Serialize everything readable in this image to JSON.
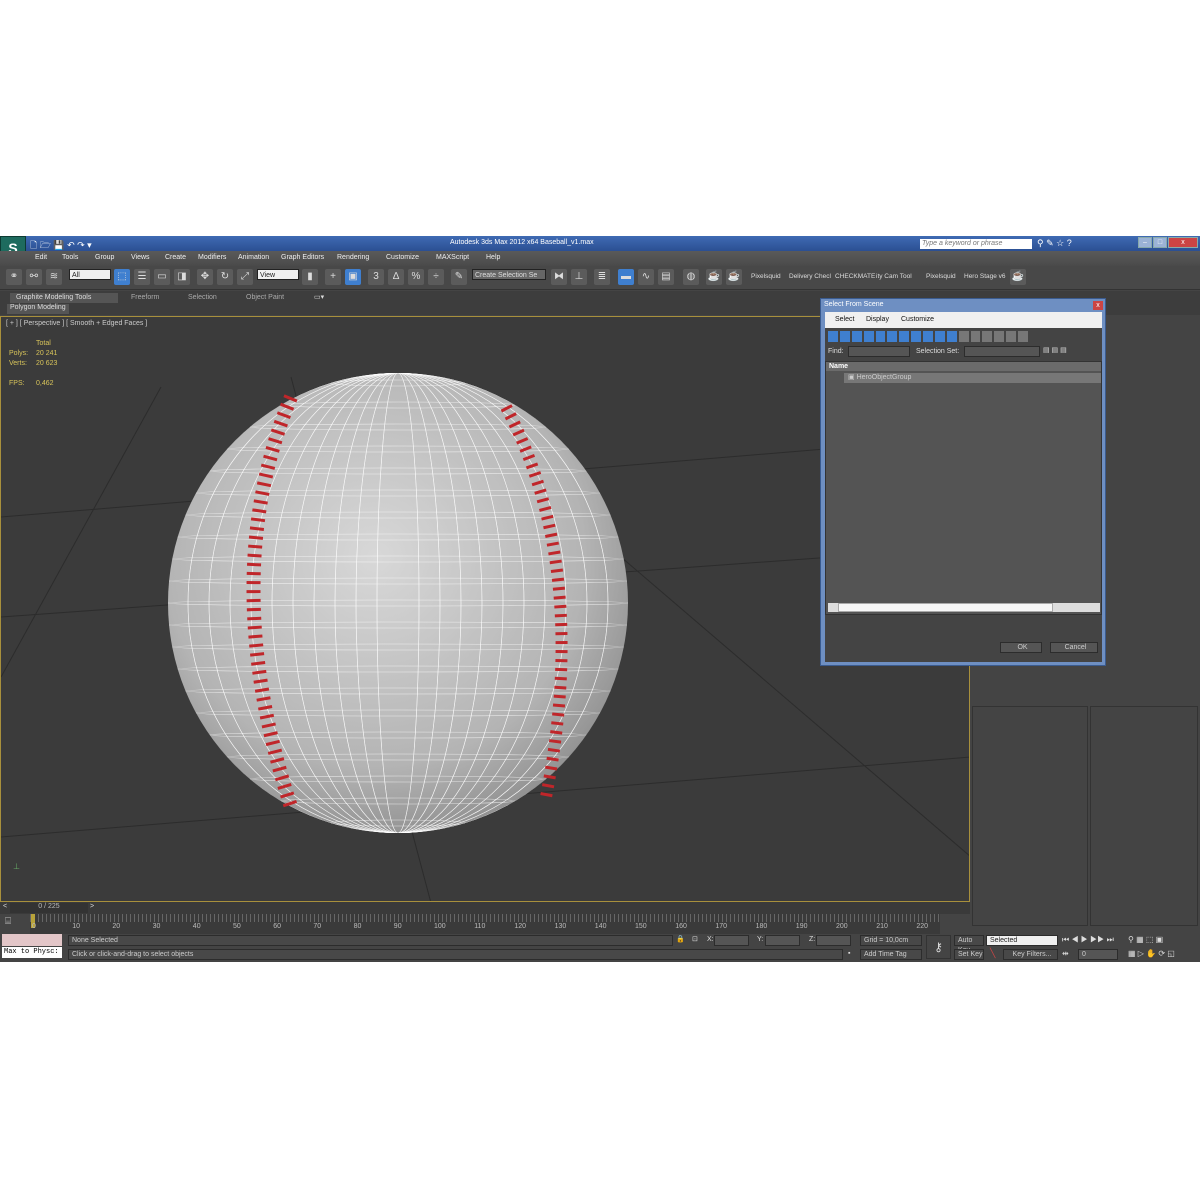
{
  "title": "Autodesk 3ds Max  2012 x64      Baseball_v1.max",
  "search_placeholder": "Type a keyword or phrase",
  "menu": [
    "Edit",
    "Tools",
    "Group",
    "Views",
    "Create",
    "Modifiers",
    "Animation",
    "Graph Editors",
    "Rendering",
    "Customize",
    "MAXScript",
    "Help"
  ],
  "toolbar": {
    "filter": "All",
    "ref_coord": "View",
    "selection_set": "Create Selection Se",
    "plugins": [
      "Pixelsquid",
      "Delivery Checl",
      "CHECKMATE",
      "ity Cam Tool",
      "Pixelsquid",
      "Hero Stage v6"
    ]
  },
  "ribbon": {
    "tabs": [
      "Graphite Modeling Tools",
      "Freeform",
      "Selection",
      "Object Paint"
    ],
    "panel": "Polygon Modeling"
  },
  "viewport": {
    "label": "[ + ] [ Perspective ] [ Smooth + Edged Faces ]",
    "stats": {
      "total": "Total",
      "polys_label": "Polys:",
      "polys": "20 241",
      "verts_label": "Verts:",
      "verts": "20 623",
      "fps_label": "FPS:",
      "fps": "0,462"
    }
  },
  "timeline": {
    "frame": "0 / 225",
    "ticks": [
      "0",
      "10",
      "20",
      "30",
      "40",
      "50",
      "60",
      "70",
      "80",
      "90",
      "100",
      "110",
      "120",
      "130",
      "140",
      "150",
      "160",
      "170",
      "180",
      "190",
      "200",
      "210",
      "220"
    ]
  },
  "status": {
    "selection": "None Selected",
    "prompt": "Click or click-and-drag to select objects",
    "script": "Max to Physc:",
    "x_label": "X:",
    "y_label": "Y:",
    "z_label": "Z:",
    "grid": "Grid = 10,0cm",
    "add_time_tag": "Add Time Tag",
    "auto_key": "Auto Key",
    "set_key": "Set Key",
    "key_mode": "Selected",
    "key_filters": "Key Filters...",
    "frame_value": "0"
  },
  "dialog": {
    "title": "Select From Scene",
    "menu": [
      "Select",
      "Display",
      "Customize"
    ],
    "find_label": "Find:",
    "selection_set_label": "Selection Set:",
    "column": "Name",
    "items": [
      "HeroObjectGroup"
    ],
    "ok": "OK",
    "cancel": "Cancel"
  },
  "colors": {
    "accent": "#3f7fcf",
    "viewport_border": "#a8903c",
    "stats": "#d8c45a",
    "stitch": "#c0262a"
  }
}
